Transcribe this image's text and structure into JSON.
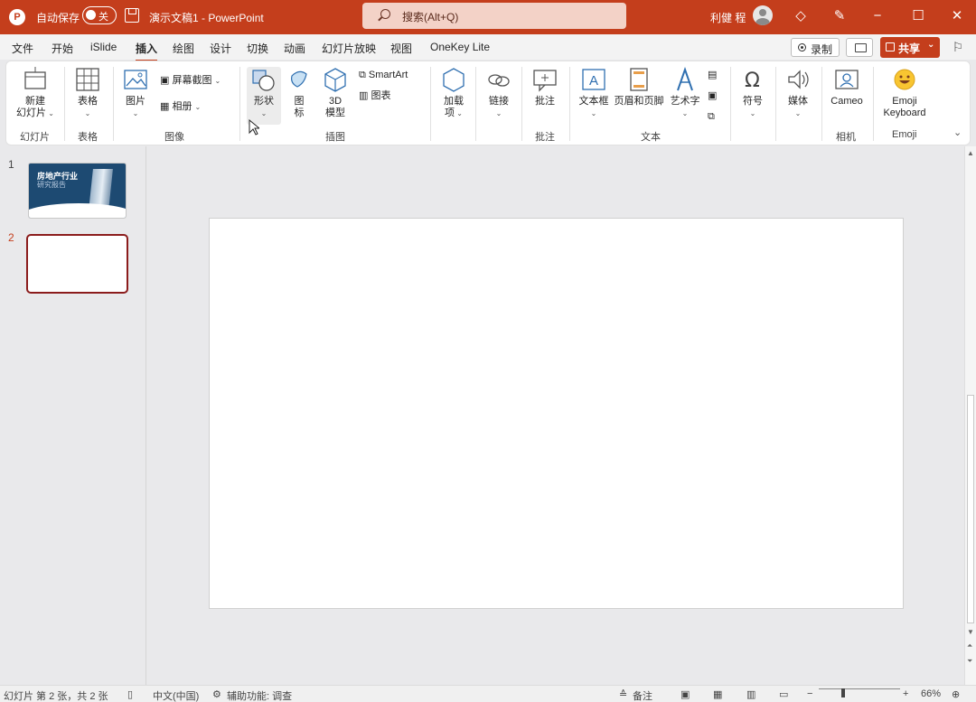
{
  "titlebar": {
    "autosave_label": "自动保存",
    "autosave_state": "关",
    "doc_title": "演示文稿1  -  PowerPoint",
    "search_placeholder": "搜索(Alt+Q)",
    "user_name": "利健 程",
    "logo": "P",
    "accent_color": "#c43e1c"
  },
  "menu": {
    "tabs": [
      "文件",
      "开始",
      "iSlide",
      "插入",
      "绘图",
      "设计",
      "切换",
      "动画",
      "幻灯片放映",
      "视图",
      "OneKey Lite"
    ],
    "active_tab": "插入",
    "record_label": "录制",
    "share_label": "共享"
  },
  "ribbon": {
    "new_slide": "新建\n幻灯片",
    "table": "表格",
    "picture": "图片",
    "screenshot": "屏幕截图",
    "album": "相册",
    "shapes": "形状",
    "icons": "图\n标",
    "model3d": "3D\n模型",
    "smartart": "SmartArt",
    "chart": "图表",
    "addins": "加载\n项",
    "link": "链接",
    "comment": "批注",
    "textbox": "文本框",
    "header_footer": "页眉和页脚",
    "wordart": "艺术字",
    "symbol": "符号",
    "media": "媒体",
    "cameo": "Cameo",
    "emoji": "Emoji\nKeyboard",
    "groups": {
      "slides": "幻灯片",
      "tables": "表格",
      "images": "图像",
      "illustrations": "插图",
      "comments": "批注",
      "text": "文本",
      "camera": "相机",
      "emoji": "Emoji"
    }
  },
  "slides": {
    "numbers": [
      "1",
      "2"
    ],
    "thumb1_title": "房地产行业",
    "thumb1_subtitle": "研究报告"
  },
  "status": {
    "slide_info": "幻灯片 第 2 张，共 2 张",
    "language": "中文(中国)",
    "accessibility": "辅助功能: 调查",
    "notes": "备注",
    "zoom": "66%"
  }
}
